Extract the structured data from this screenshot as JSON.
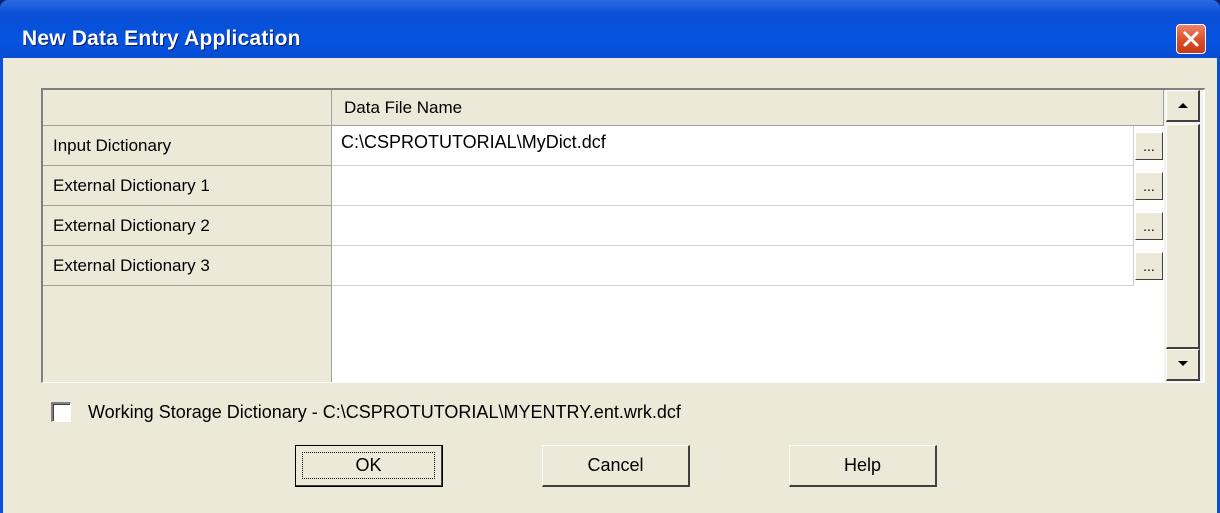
{
  "window": {
    "title": "New Data Entry Application"
  },
  "grid": {
    "column_header": "Data File Name",
    "rows": [
      {
        "label": "Input Dictionary",
        "value": "C:\\CSPROTUTORIAL\\MyDict.dcf",
        "browse": "..."
      },
      {
        "label": "External Dictionary 1",
        "value": "",
        "browse": "..."
      },
      {
        "label": "External Dictionary 2",
        "value": "",
        "browse": "..."
      },
      {
        "label": "External Dictionary 3",
        "value": "",
        "browse": "..."
      }
    ]
  },
  "working_storage": {
    "checked": false,
    "label": "Working Storage Dictionary - C:\\CSPROTUTORIAL\\MYENTRY.ent.wrk.dcf"
  },
  "buttons": {
    "ok": "OK",
    "cancel": "Cancel",
    "help": "Help"
  },
  "colors": {
    "titlebar": "#0454e1",
    "face": "#ece9d8",
    "close": "#d9542c"
  }
}
